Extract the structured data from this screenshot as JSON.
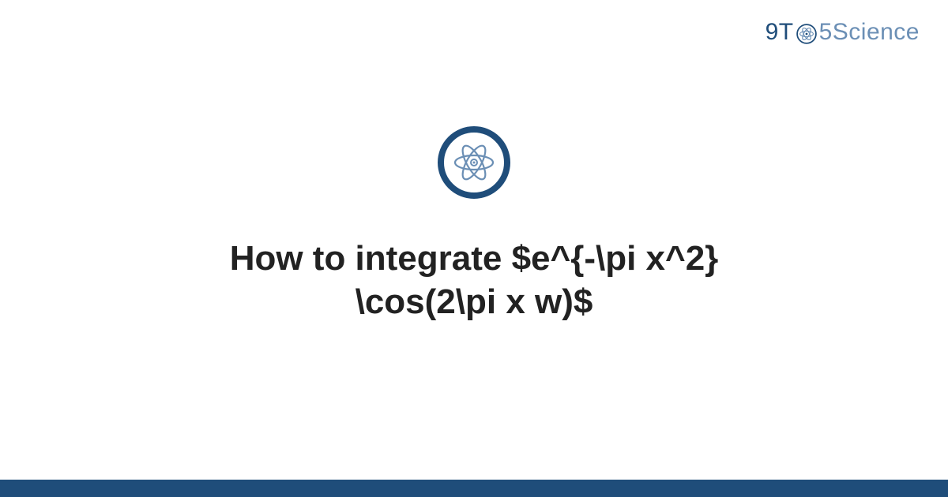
{
  "brand": {
    "part1": "9T",
    "part2": "5Science"
  },
  "icons": {
    "atom": "atom-icon"
  },
  "title": {
    "line1": "How to integrate $e^{-\\pi x^2}",
    "line2": "\\cos(2\\pi x w)$"
  },
  "colors": {
    "primary": "#1f4d7a",
    "secondary": "#6b8fb5",
    "text": "#222222",
    "background": "#ffffff"
  }
}
